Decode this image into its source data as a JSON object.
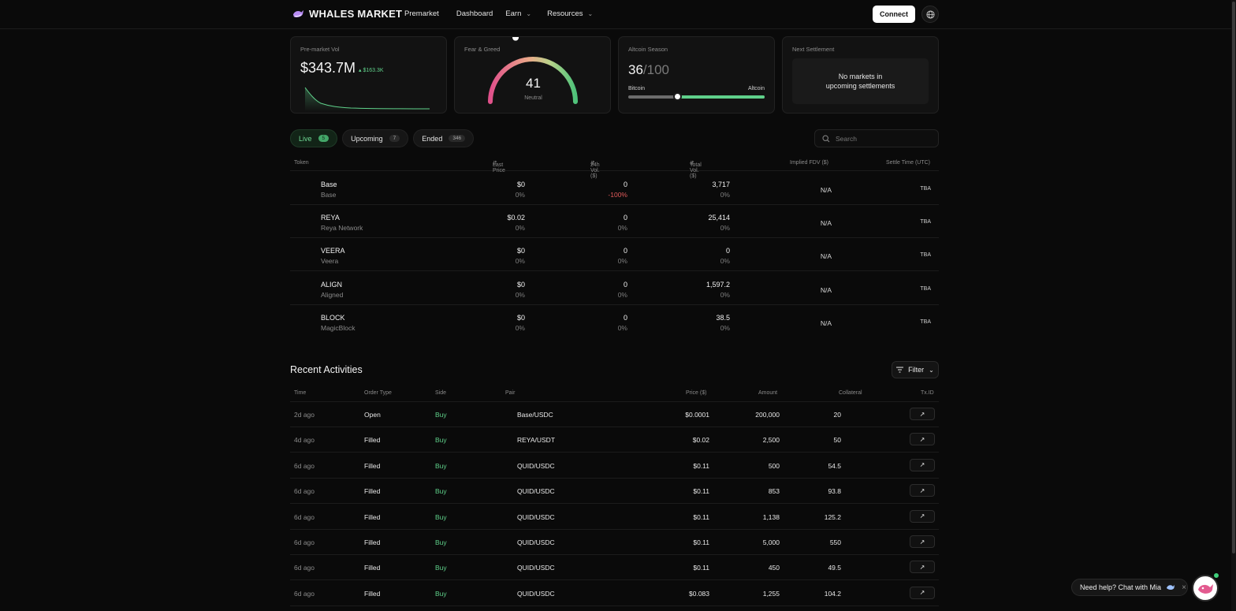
{
  "brand": {
    "name": "WHALES MARKET"
  },
  "nav": {
    "items": [
      {
        "label": "Premarket",
        "dropdown": false
      },
      {
        "label": "Dashboard",
        "dropdown": false
      },
      {
        "label": "Earn",
        "dropdown": true
      },
      {
        "label": "Resources",
        "dropdown": true
      }
    ],
    "connect_label": "Connect"
  },
  "stats": {
    "premarket": {
      "title": "Pre-market Vol",
      "value": "$343.7M",
      "delta": "$163.3K"
    },
    "fear_greed": {
      "title": "Fear & Greed",
      "value": "41",
      "label": "Neutral",
      "level": 41
    },
    "altcoin": {
      "title": "Altcoin Season",
      "value": "36",
      "denominator": "/100",
      "left_label": "Bitcoin",
      "right_label": "Altcoin",
      "level": 0.36
    },
    "settlement": {
      "title": "Next Settlement",
      "message_line1": "No markets in",
      "message_line2": "upcoming settlements"
    }
  },
  "tabs": [
    {
      "label": "Live",
      "count": "5",
      "active": true
    },
    {
      "label": "Upcoming",
      "count": "7",
      "active": false
    },
    {
      "label": "Ended",
      "count": "346",
      "active": false
    }
  ],
  "search": {
    "placeholder": "Search"
  },
  "markets": {
    "headers": {
      "token": "Token",
      "last_price": "Last Price",
      "vol24": "24h Vol. ($)",
      "total_vol": "Total Vol. ($)",
      "fdv": "Implied FDV ($)",
      "settle": "Settle Time (UTC)"
    },
    "rows": [
      {
        "symbol": "Base",
        "name": "Base",
        "price": "$0",
        "price_chg": "0%",
        "vol24": "0",
        "vol24_chg": "-100%",
        "vol24_neg": true,
        "total": "3,717",
        "total_chg": "0%",
        "fdv": "N/A",
        "settle": "TBA"
      },
      {
        "symbol": "REYA",
        "name": "Reya Network",
        "price": "$0.02",
        "price_chg": "0%",
        "vol24": "0",
        "vol24_chg": "0%",
        "vol24_neg": false,
        "total": "25,414",
        "total_chg": "0%",
        "fdv": "N/A",
        "settle": "TBA"
      },
      {
        "symbol": "VEERA",
        "name": "Veera",
        "price": "$0",
        "price_chg": "0%",
        "vol24": "0",
        "vol24_chg": "0%",
        "vol24_neg": false,
        "total": "0",
        "total_chg": "0%",
        "fdv": "N/A",
        "settle": "TBA"
      },
      {
        "symbol": "ALIGN",
        "name": "Aligned",
        "price": "$0",
        "price_chg": "0%",
        "vol24": "0",
        "vol24_chg": "0%",
        "vol24_neg": false,
        "total": "1,597.2",
        "total_chg": "0%",
        "fdv": "N/A",
        "settle": "TBA"
      },
      {
        "symbol": "BLOCK",
        "name": "MagicBlock",
        "price": "$0",
        "price_chg": "0%",
        "vol24": "0",
        "vol24_chg": "0%",
        "vol24_neg": false,
        "total": "38.5",
        "total_chg": "0%",
        "fdv": "N/A",
        "settle": "TBA"
      }
    ]
  },
  "activities": {
    "title": "Recent Activities",
    "filter_label": "Filter",
    "headers": {
      "time": "Time",
      "order_type": "Order Type",
      "side": "Side",
      "pair": "Pair",
      "price": "Price ($)",
      "amount": "Amount",
      "collateral": "Collateral",
      "tx": "Tx.ID"
    },
    "rows": [
      {
        "time": "2d ago",
        "type": "Open",
        "side": "Buy",
        "pair": "Base/USDC",
        "price": "$0.0001",
        "amount": "200,000",
        "collateral": "20"
      },
      {
        "time": "4d ago",
        "type": "Filled",
        "side": "Buy",
        "pair": "REYA/USDT",
        "price": "$0.02",
        "amount": "2,500",
        "collateral": "50"
      },
      {
        "time": "6d ago",
        "type": "Filled",
        "side": "Buy",
        "pair": "QUID/USDC",
        "price": "$0.11",
        "amount": "500",
        "collateral": "54.5"
      },
      {
        "time": "6d ago",
        "type": "Filled",
        "side": "Buy",
        "pair": "QUID/USDC",
        "price": "$0.11",
        "amount": "853",
        "collateral": "93.8"
      },
      {
        "time": "6d ago",
        "type": "Filled",
        "side": "Buy",
        "pair": "QUID/USDC",
        "price": "$0.11",
        "amount": "1,138",
        "collateral": "125.2"
      },
      {
        "time": "6d ago",
        "type": "Filled",
        "side": "Buy",
        "pair": "QUID/USDC",
        "price": "$0.11",
        "amount": "5,000",
        "collateral": "550"
      },
      {
        "time": "6d ago",
        "type": "Filled",
        "side": "Buy",
        "pair": "QUID/USDC",
        "price": "$0.11",
        "amount": "450",
        "collateral": "49.5"
      },
      {
        "time": "6d ago",
        "type": "Filled",
        "side": "Buy",
        "pair": "QUID/USDC",
        "price": "$0.083",
        "amount": "1,255",
        "collateral": "104.2"
      }
    ]
  },
  "chat": {
    "label": "Need help? Chat with Mia"
  },
  "colors": {
    "accent_green": "#5fd08a",
    "negative_red": "#e05a5a",
    "background": "#0a0a0a"
  },
  "icons": {
    "logo": "whale-logo-icon",
    "globe": "globe-icon",
    "search": "search-icon",
    "filter": "filter-icon",
    "tx": "arrow-up-right-icon",
    "chat_avatar": "mia-avatar-icon"
  }
}
